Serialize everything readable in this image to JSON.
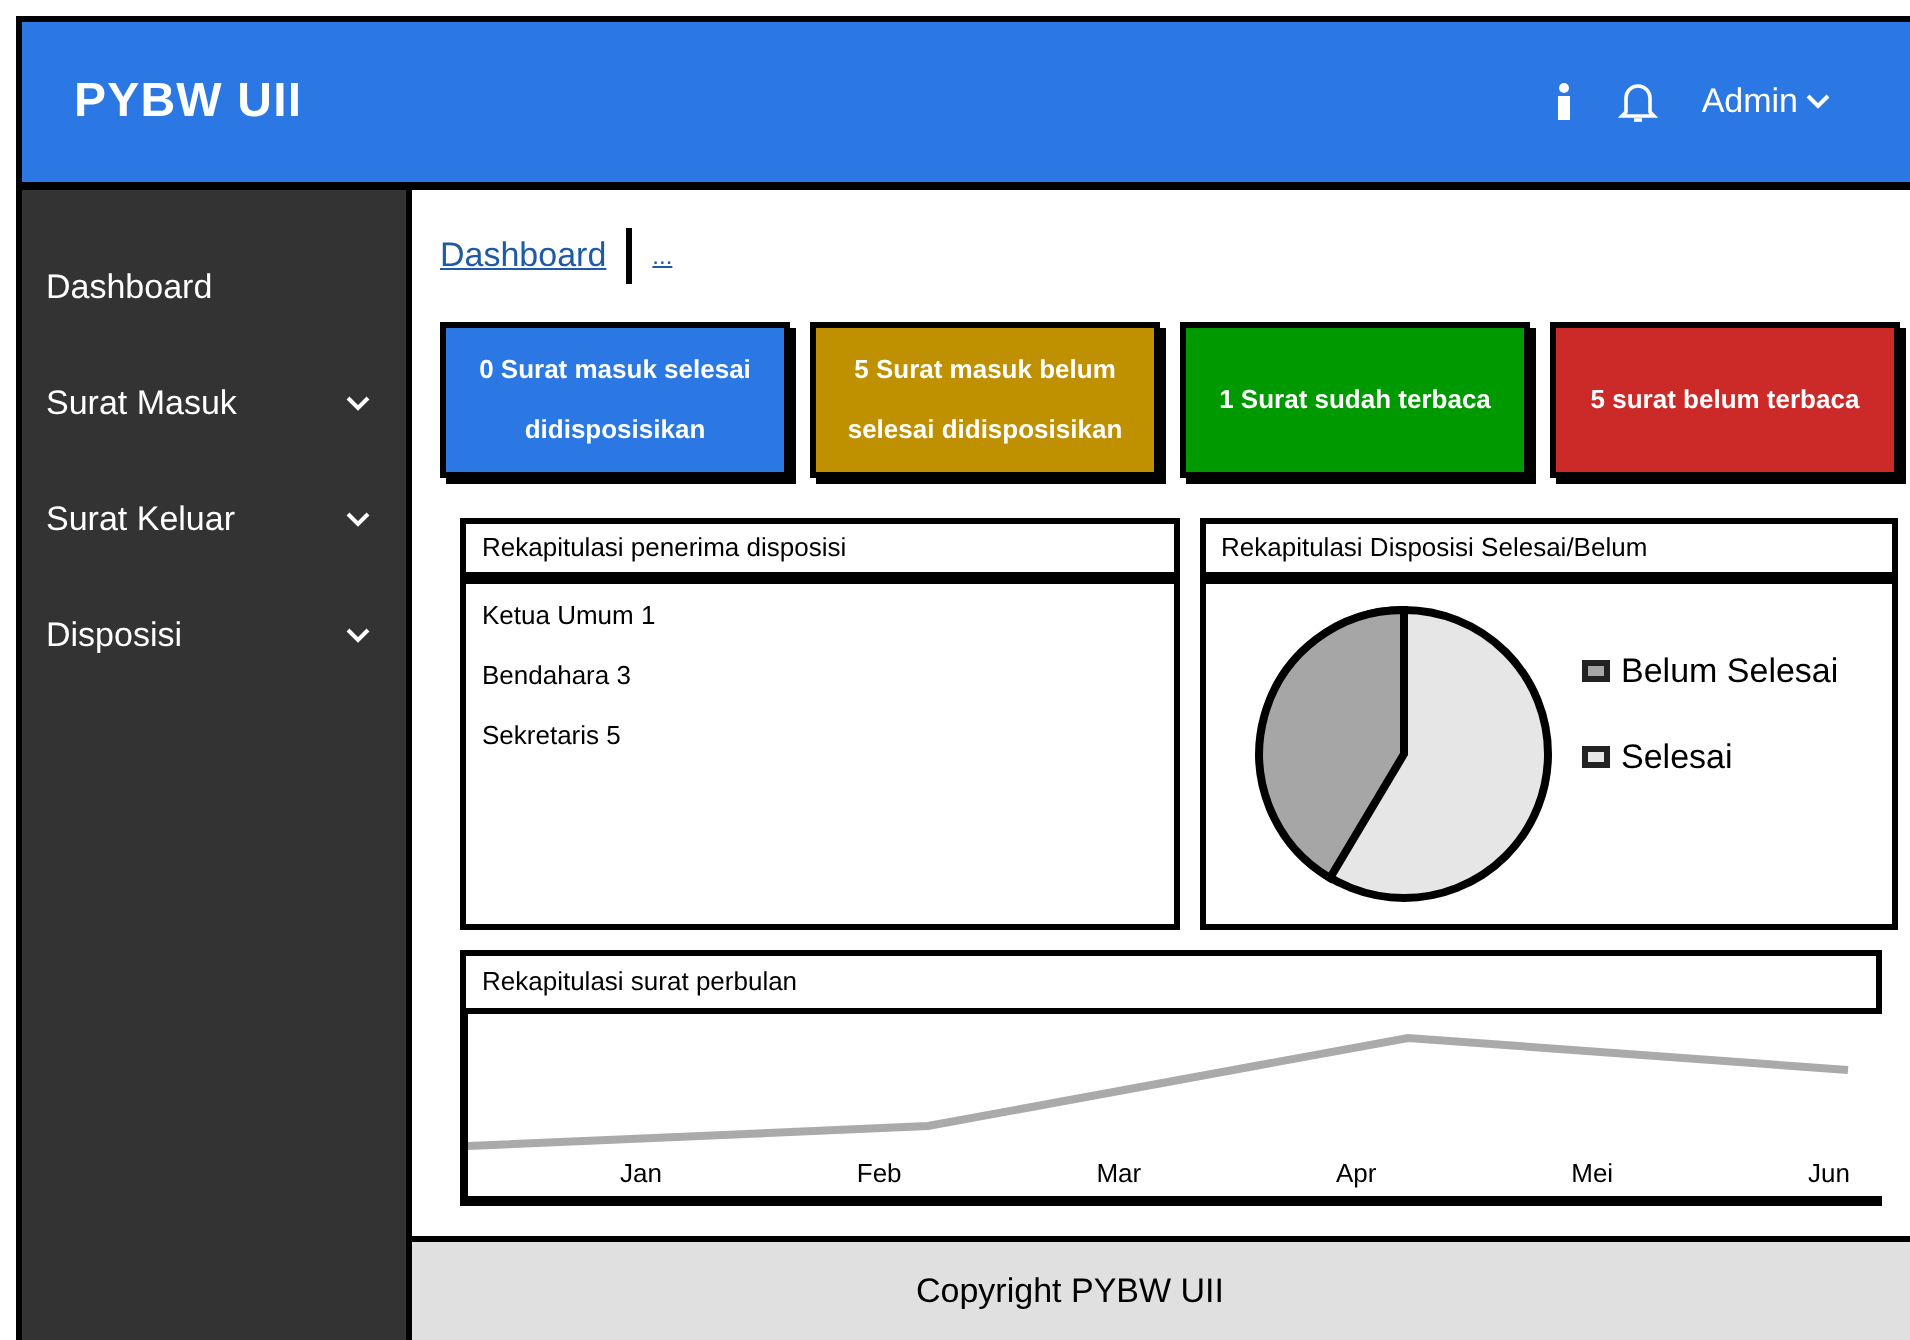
{
  "header": {
    "title": "PYBW UII",
    "user": "Admin"
  },
  "sidebar": {
    "items": [
      {
        "label": "Dashboard",
        "expandable": false
      },
      {
        "label": "Surat Masuk",
        "expandable": true
      },
      {
        "label": "Surat Keluar",
        "expandable": true
      },
      {
        "label": "Disposisi",
        "expandable": true
      }
    ]
  },
  "breadcrumb": [
    "Dashboard",
    "..."
  ],
  "cards": [
    {
      "text": "0 Surat masuk selesai didisposisikan",
      "color": "#2b78e4"
    },
    {
      "text": "5 Surat masuk belum selesai didisposisikan",
      "color": "#bf9000"
    },
    {
      "text": "1 Surat sudah terbaca",
      "color": "#009900"
    },
    {
      "text": "5 surat belum terbaca",
      "color": "#cc2929"
    }
  ],
  "recipients_panel": {
    "title": "Rekapitulasi penerima disposisi",
    "items": [
      "Ketua Umum 1",
      "Bendahara 3",
      "Sekretaris 5"
    ]
  },
  "status_panel": {
    "title": "Rekapitulasi Disposisi Selesai/Belum",
    "legend": [
      {
        "label": "Belum Selesai",
        "color": "#a6a6a6"
      },
      {
        "label": "Selesai",
        "color": "#e6e6e6"
      }
    ]
  },
  "monthly_panel": {
    "title": "Rekapitulasi surat perbulan",
    "months": [
      "Jan",
      "Feb",
      "Mar",
      "Apr",
      "Mei",
      "Jun"
    ]
  },
  "footer": "Copyright PYBW UII"
}
